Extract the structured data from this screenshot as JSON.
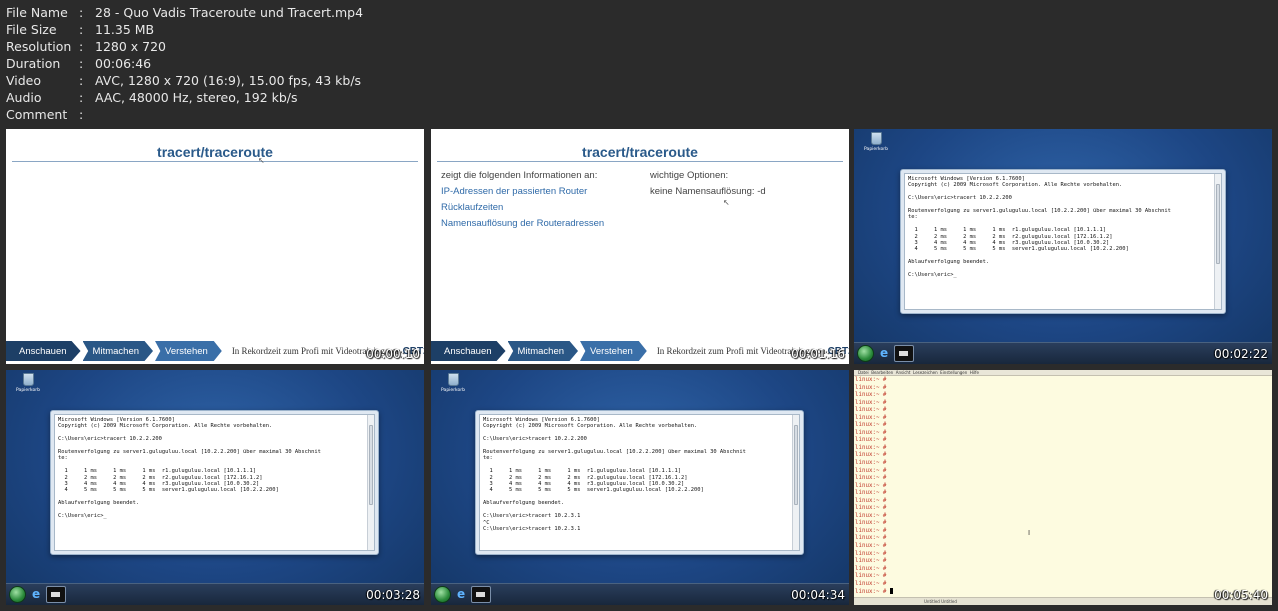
{
  "meta": [
    {
      "key": "File Name",
      "value": "28 - Quo Vadis Traceroute und Tracert.mp4"
    },
    {
      "key": "File Size",
      "value": "11.35 MB"
    },
    {
      "key": "Resolution",
      "value": "1280 x 720"
    },
    {
      "key": "Duration",
      "value": "00:06:46"
    },
    {
      "key": "Video",
      "value": "AVC, 1280 x 720 (16:9), 15.00 fps, 43 kb/s"
    },
    {
      "key": "Audio",
      "value": "AAC, 48000 Hz, stereo, 192 kb/s"
    },
    {
      "key": "Comment",
      "value": ""
    }
  ],
  "slides": {
    "title": "tracert/traceroute",
    "footer": {
      "step1": "Anschauen",
      "step2": "Mitmachen",
      "step3": "Verstehen",
      "slogan": "In Rekordzeit zum Profi mit Videotraining von",
      "logo": "CBT24"
    },
    "slide2": {
      "intro": "zeigt die folgenden Informationen an:",
      "items": [
        "IP-Adressen der passierten Router",
        "Rücklaufzeiten",
        "Namensauflösung der Routeradressen"
      ],
      "options_heading": "wichtige Optionen:",
      "option1": "keine Namensauflösung: -d"
    }
  },
  "desktop": {
    "recycle_label": "Papierkorb"
  },
  "cmd_output": {
    "base": "Microsoft Windows [Version 6.1.7600]\nCopyright (c) 2009 Microsoft Corporation. Alle Rechte vorbehalten.\n\nC:\\Users\\eric>tracert 10.2.2.200\n\nRoutenverfolgung zu server1.guluguluu.local [10.2.2.200] über maximal 30 Abschnit\nte:\n\n  1     1 ms     1 ms     1 ms  r1.guluguluu.local [10.1.1.1]\n  2     2 ms     2 ms     2 ms  r2.guluguluu.local [172.16.1.2]\n  3     4 ms     4 ms     4 ms  r3.guluguluu.local [10.0.30.2]\n  4     5 ms     5 ms     5 ms  server1.guluguluu.local [10.2.2.200]\n\nAblaufverfolgung beendet.\n\nC:\\Users\\eric>_",
    "base2": "Microsoft Windows [Version 6.1.7600]\nCopyright (c) 2009 Microsoft Corporation. Alle Rechte vorbehalten.\n\nC:\\Users\\eric>tracert 10.2.2.200\n\nRoutenverfolgung zu server1.guluguluu.local [10.2.2.200] über maximal 30 Abschnit\nte:\n\n  1     1 ms     1 ms     1 ms  r1.guluguluu.local [10.1.1.1]\n  2     2 ms     2 ms     2 ms  r2.guluguluu.local [172.16.1.2]\n  3     4 ms     4 ms     4 ms  r3.guluguluu.local [10.0.30.2]\n  4     5 ms     5 ms     5 ms  server1.guluguluu.local [10.2.2.200]\n\nAblaufverfolgung beendet.\n\nC:\\Users\\eric>tracert 10.2.3.1\n^C\nC:\\Users\\eric>tracert 10.2.3.1"
  },
  "linux": {
    "menubar": "Datei  Bearbeiten  Ansicht  Lesezeichen  Einstellungen  Hilfe",
    "prompt": "linux:~ #",
    "status": "Untitled  Untitled"
  },
  "timestamps": [
    "00:00:10",
    "00:01:16",
    "00:02:22",
    "00:03:28",
    "00:04:34",
    "00:05:40"
  ]
}
